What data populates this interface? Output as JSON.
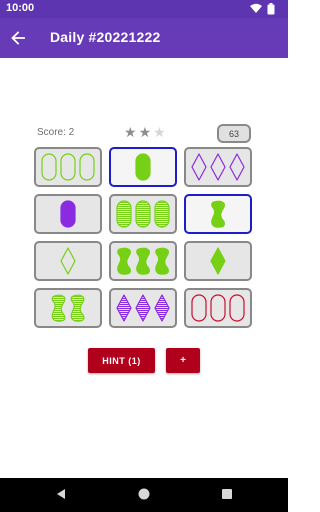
{
  "status_bar": {
    "time": "10:00"
  },
  "app_bar": {
    "title": "Daily #20221222",
    "back_icon": "arrow-back-icon"
  },
  "game": {
    "score_label": "Score: 2",
    "stars": {
      "filled": 2,
      "total": 3
    },
    "deck_count": "63",
    "colors": {
      "green": "#76d016",
      "purple": "#8a2be2",
      "red": "#c8102e",
      "star_filled": "#8d8d8d",
      "star_empty": "#d6d6d6",
      "selected_border": "#1e1ec8"
    },
    "cards": [
      {
        "count": 3,
        "shape": "oval",
        "fill": "empty",
        "color": "green",
        "selected": false
      },
      {
        "count": 1,
        "shape": "oval",
        "fill": "solid",
        "color": "green",
        "selected": true
      },
      {
        "count": 3,
        "shape": "diamond",
        "fill": "empty",
        "color": "purple",
        "selected": false
      },
      {
        "count": 1,
        "shape": "oval",
        "fill": "solid",
        "color": "purple",
        "selected": false
      },
      {
        "count": 3,
        "shape": "oval",
        "fill": "striped",
        "color": "green",
        "selected": false
      },
      {
        "count": 1,
        "shape": "squiggle",
        "fill": "solid",
        "color": "green",
        "selected": true
      },
      {
        "count": 1,
        "shape": "diamond",
        "fill": "empty",
        "color": "green",
        "selected": false
      },
      {
        "count": 3,
        "shape": "squiggle",
        "fill": "solid",
        "color": "green",
        "selected": false
      },
      {
        "count": 1,
        "shape": "diamond",
        "fill": "solid",
        "color": "green",
        "selected": false
      },
      {
        "count": 2,
        "shape": "squiggle",
        "fill": "striped",
        "color": "green",
        "selected": false
      },
      {
        "count": 3,
        "shape": "diamond",
        "fill": "striped",
        "color": "purple",
        "selected": false
      },
      {
        "count": 3,
        "shape": "oval",
        "fill": "empty",
        "color": "red",
        "selected": false
      }
    ]
  },
  "buttons": {
    "hint_label": "HINT (1)",
    "plus_label": "+"
  }
}
